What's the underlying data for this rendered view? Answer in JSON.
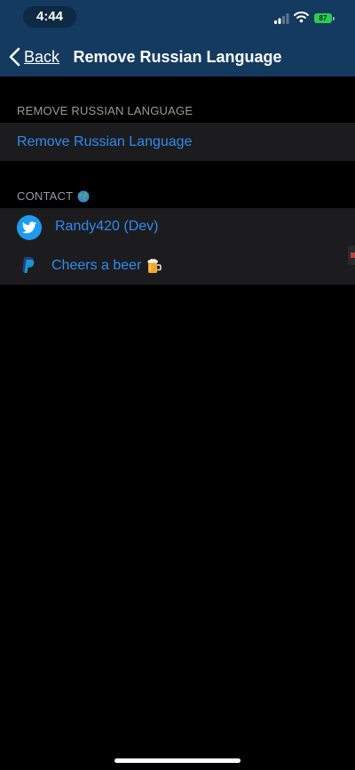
{
  "status_bar": {
    "time": "4:44",
    "battery_level": "87",
    "signal_icon": "cellular-signal-icon",
    "wifi_icon": "wifi-icon"
  },
  "nav": {
    "back_label": "Back",
    "back_icon": "chevron-left-icon",
    "title": "Remove Russian Language"
  },
  "sections": {
    "remove": {
      "header": "REMOVE RUSSIAN LANGUAGE",
      "items": [
        {
          "label": "Remove Russian Language"
        }
      ]
    },
    "contact": {
      "header": "CONTACT",
      "header_icon": "globe-icon",
      "items": [
        {
          "label": "Randy420 (Dev)",
          "icon": "twitter-icon"
        },
        {
          "label": "Cheers a beer",
          "icon": "paypal-icon",
          "trailing_icon": "beer-icon"
        }
      ]
    }
  },
  "colors": {
    "nav_background": "#143a5f",
    "link": "#2e8bf0",
    "group_background": "#1c1c1e",
    "section_header": "#9a9a9e",
    "battery": "#2ecc52"
  }
}
